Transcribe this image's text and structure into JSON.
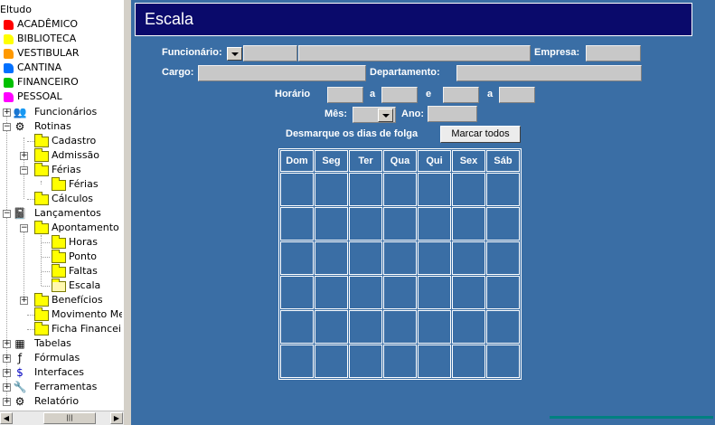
{
  "tree": {
    "root": "Eltudo",
    "modules": [
      {
        "label": "ACADÊMICO",
        "color": "#ff0000"
      },
      {
        "label": "BIBLIOTECA",
        "color": "#ffff00"
      },
      {
        "label": "VESTIBULAR",
        "color": "#ff9900"
      },
      {
        "label": "CANTINA",
        "color": "#0070ff"
      },
      {
        "label": "FINANCEIRO",
        "color": "#00c000"
      },
      {
        "label": "PESSOAL",
        "color": "#ff00ff"
      }
    ],
    "funcionarios": "Funcionários",
    "rotinas": "Rotinas",
    "cadastro": "Cadastro",
    "admissao": "Admissão",
    "ferias": "Férias",
    "ferias_child": "Férias",
    "calculos": "Cálculos",
    "lancamentos": "Lançamentos",
    "apontamento": "Apontamento",
    "horas": "Horas",
    "ponto": "Ponto",
    "faltas": "Faltas",
    "escala": "Escala",
    "beneficios": "Benefícios",
    "movimento": "Movimento Mensal",
    "ficha": "Ficha Financeira",
    "tabelas": "Tabelas",
    "formulas": "Fórmulas",
    "interfaces": "Interfaces",
    "ferramentas": "Ferramentas",
    "relatorio": "Relatório"
  },
  "form": {
    "title": "Escala",
    "funcionario_label": "Funcionário:",
    "empresa_label": "Empresa:",
    "cargo_label": "Cargo:",
    "departamento_label": "Departamento:",
    "horario_label": "Horário",
    "a_label": "a",
    "e_label": "e",
    "a2_label": "a",
    "mes_label": "Mês:",
    "ano_label": "Ano:",
    "desmarque_label": "Desmarque os dias de folga",
    "marcar_button": "Marcar todos",
    "days": [
      "Dom",
      "Seg",
      "Ter",
      "Qua",
      "Qui",
      "Sex",
      "Sáb"
    ]
  },
  "colors": {
    "panel_bg": "#3a6ea5",
    "title_bg": "#0a0a6b",
    "field_bg": "#c8c8c8"
  }
}
